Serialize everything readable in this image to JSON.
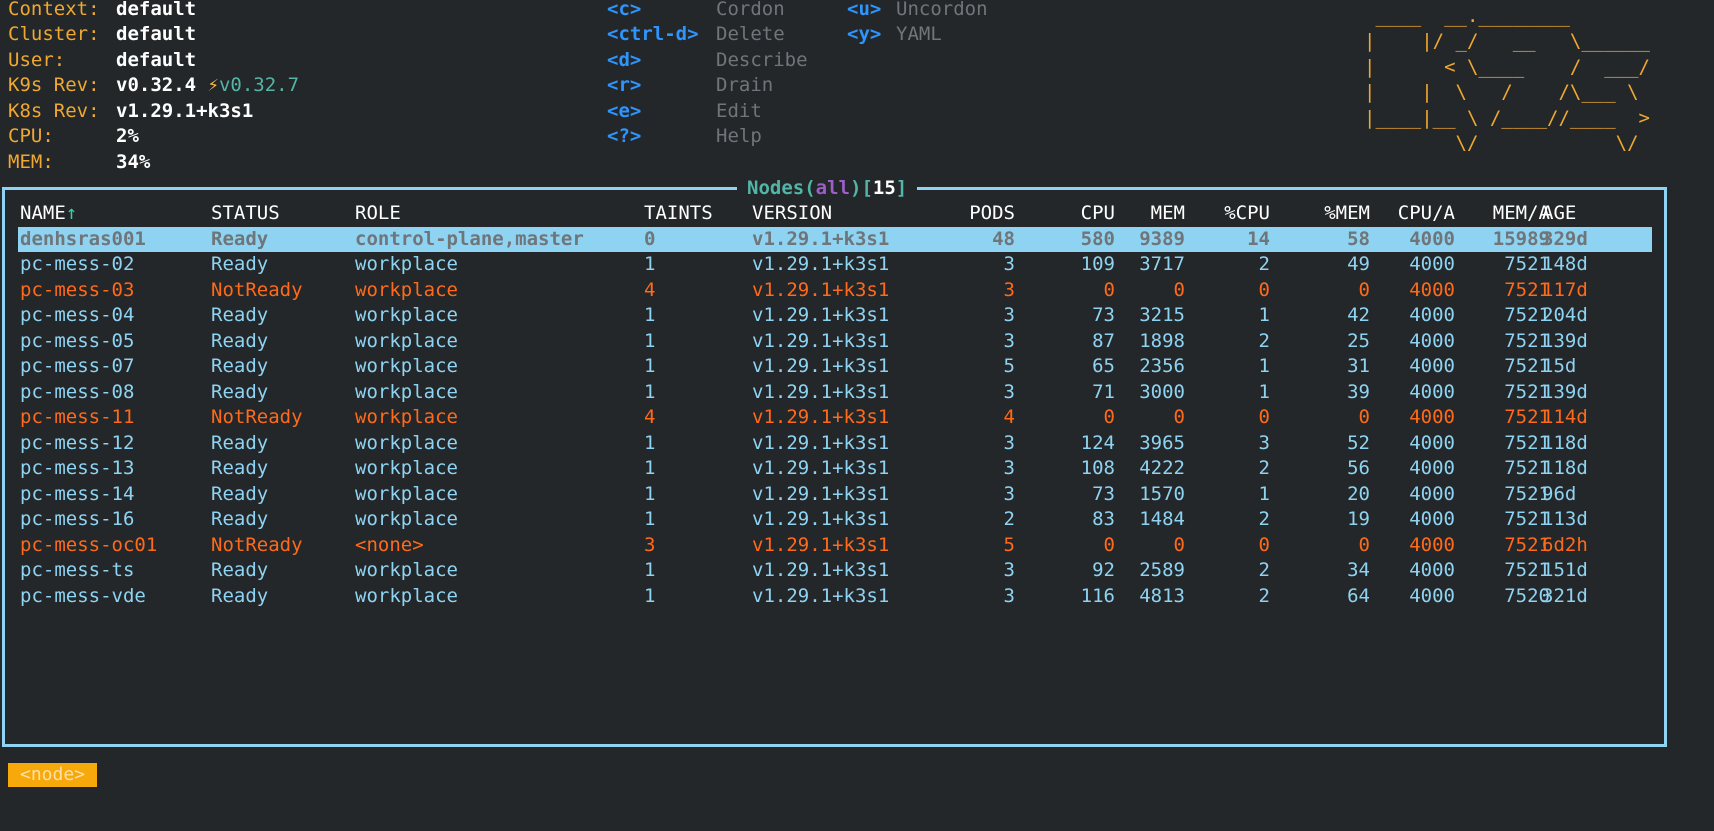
{
  "info": [
    {
      "label": "Context:",
      "value": "default"
    },
    {
      "label": "Cluster:",
      "value": "default"
    },
    {
      "label": "User:",
      "value": "default"
    },
    {
      "label": "K9s Rev:",
      "value": "v0.32.4",
      "upgrade": "v0.32.7"
    },
    {
      "label": "K8s Rev:",
      "value": "v1.29.1+k3s1"
    },
    {
      "label": "CPU:",
      "value": "2%"
    },
    {
      "label": "MEM:",
      "value": "34%"
    }
  ],
  "shortcuts": [
    {
      "key": "<c>",
      "label": "Cordon"
    },
    {
      "key": "<ctrl-d>",
      "label": "Delete"
    },
    {
      "key": "<d>",
      "label": "Describe"
    },
    {
      "key": "<r>",
      "label": "Drain"
    },
    {
      "key": "<e>",
      "label": "Edit"
    },
    {
      "key": "<?>",
      "label": "Help"
    },
    {
      "key": "<u>",
      "label": "Uncordon"
    },
    {
      "key": "<y>",
      "label": "YAML"
    }
  ],
  "logo": [
    " ____  __.________       ",
    "|    |/ _/   __   \\______",
    "|      < \\____    /  ___/",
    "|    |  \\   /    /\\___ \\ ",
    "|____|__ \\ /____//____  >",
    "        \\/            \\/ "
  ],
  "frame": {
    "resource": "Nodes",
    "open": "(",
    "scope": "all",
    "close": ")",
    "lb": "[",
    "count": "15",
    "rb": "]"
  },
  "table": {
    "headers": [
      "NAME",
      "STATUS",
      "ROLE",
      "TAINTS",
      "VERSION",
      "PODS",
      "CPU",
      "MEM",
      "%CPU",
      "%MEM",
      "CPU/A",
      "MEM/A",
      "AGE"
    ],
    "sort_indicator": "↑",
    "rows": [
      {
        "state": "selected",
        "cells": [
          "denhsras001",
          "Ready",
          "control-plane,master",
          "0",
          "v1.29.1+k3s1",
          "48",
          "580",
          "9389",
          "14",
          "58",
          "4000",
          "15989",
          "329d"
        ]
      },
      {
        "state": "ok",
        "cells": [
          "pc-mess-02",
          "Ready",
          "workplace",
          "1",
          "v1.29.1+k3s1",
          "3",
          "109",
          "3717",
          "2",
          "49",
          "4000",
          "7521",
          "148d"
        ]
      },
      {
        "state": "bad",
        "cells": [
          "pc-mess-03",
          "NotReady",
          "workplace",
          "4",
          "v1.29.1+k3s1",
          "3",
          "0",
          "0",
          "0",
          "0",
          "4000",
          "7521",
          "117d"
        ]
      },
      {
        "state": "ok",
        "cells": [
          "pc-mess-04",
          "Ready",
          "workplace",
          "1",
          "v1.29.1+k3s1",
          "3",
          "73",
          "3215",
          "1",
          "42",
          "4000",
          "7521",
          "204d"
        ]
      },
      {
        "state": "ok",
        "cells": [
          "pc-mess-05",
          "Ready",
          "workplace",
          "1",
          "v1.29.1+k3s1",
          "3",
          "87",
          "1898",
          "2",
          "25",
          "4000",
          "7521",
          "139d"
        ]
      },
      {
        "state": "ok",
        "cells": [
          "pc-mess-07",
          "Ready",
          "workplace",
          "1",
          "v1.29.1+k3s1",
          "5",
          "65",
          "2356",
          "1",
          "31",
          "4000",
          "7521",
          "15d"
        ]
      },
      {
        "state": "ok",
        "cells": [
          "pc-mess-08",
          "Ready",
          "workplace",
          "1",
          "v1.29.1+k3s1",
          "3",
          "71",
          "3000",
          "1",
          "39",
          "4000",
          "7521",
          "139d"
        ]
      },
      {
        "state": "bad",
        "cells": [
          "pc-mess-11",
          "NotReady",
          "workplace",
          "4",
          "v1.29.1+k3s1",
          "4",
          "0",
          "0",
          "0",
          "0",
          "4000",
          "7521",
          "114d"
        ]
      },
      {
        "state": "ok",
        "cells": [
          "pc-mess-12",
          "Ready",
          "workplace",
          "1",
          "v1.29.1+k3s1",
          "3",
          "124",
          "3965",
          "3",
          "52",
          "4000",
          "7521",
          "118d"
        ]
      },
      {
        "state": "ok",
        "cells": [
          "pc-mess-13",
          "Ready",
          "workplace",
          "1",
          "v1.29.1+k3s1",
          "3",
          "108",
          "4222",
          "2",
          "56",
          "4000",
          "7521",
          "118d"
        ]
      },
      {
        "state": "ok",
        "cells": [
          "pc-mess-14",
          "Ready",
          "workplace",
          "1",
          "v1.29.1+k3s1",
          "3",
          "73",
          "1570",
          "1",
          "20",
          "4000",
          "7521",
          "96d"
        ]
      },
      {
        "state": "ok",
        "cells": [
          "pc-mess-16",
          "Ready",
          "workplace",
          "1",
          "v1.29.1+k3s1",
          "2",
          "83",
          "1484",
          "2",
          "19",
          "4000",
          "7521",
          "113d"
        ]
      },
      {
        "state": "bad",
        "cells": [
          "pc-mess-oc01",
          "NotReady",
          "<none>",
          "3",
          "v1.29.1+k3s1",
          "5",
          "0",
          "0",
          "0",
          "0",
          "4000",
          "7521",
          "6d2h"
        ]
      },
      {
        "state": "ok",
        "cells": [
          "pc-mess-ts",
          "Ready",
          "workplace",
          "1",
          "v1.29.1+k3s1",
          "3",
          "92",
          "2589",
          "2",
          "34",
          "4000",
          "7521",
          "151d"
        ]
      },
      {
        "state": "ok",
        "cells": [
          "pc-mess-vde",
          "Ready",
          "workplace",
          "1",
          "v1.29.1+k3s1",
          "3",
          "116",
          "4813",
          "2",
          "64",
          "4000",
          "7520",
          "321d"
        ]
      }
    ]
  },
  "breadcrumb": "<node>",
  "colors": {
    "background": "#232729",
    "border": "#8fd3f2",
    "ready": "#8fd3f2",
    "not_ready": "#ff6a1a",
    "key": "#2e95ff",
    "label": "#f0a830",
    "crumb": "#f7a90b"
  }
}
